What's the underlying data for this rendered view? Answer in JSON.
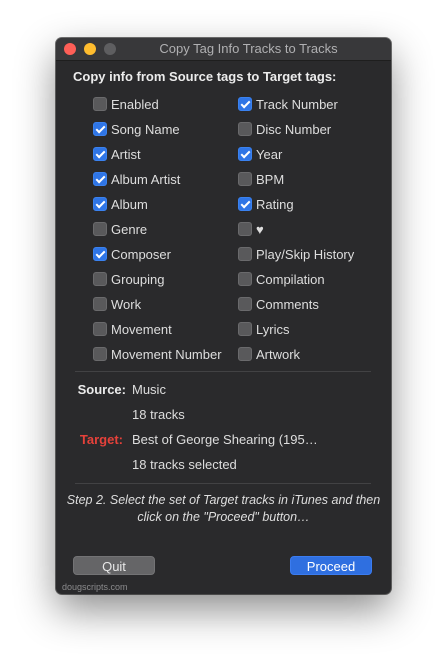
{
  "window": {
    "title": "Copy Tag Info Tracks to Tracks"
  },
  "header": "Copy info from Source tags to Target tags:",
  "tags_left": [
    {
      "label": "Enabled",
      "checked": false
    },
    {
      "label": "Song Name",
      "checked": true
    },
    {
      "label": "Artist",
      "checked": true
    },
    {
      "label": "Album Artist",
      "checked": true
    },
    {
      "label": "Album",
      "checked": true
    },
    {
      "label": "Genre",
      "checked": false
    },
    {
      "label": "Composer",
      "checked": true
    },
    {
      "label": "Grouping",
      "checked": false
    },
    {
      "label": "Work",
      "checked": false
    },
    {
      "label": "Movement",
      "checked": false
    },
    {
      "label": "Movement Number",
      "checked": false
    }
  ],
  "tags_right": [
    {
      "label": "Track Number",
      "checked": true
    },
    {
      "label": "Disc Number",
      "checked": false
    },
    {
      "label": "Year",
      "checked": true
    },
    {
      "label": "BPM",
      "checked": false
    },
    {
      "label": "Rating",
      "checked": true
    },
    {
      "label": "♥",
      "checked": false
    },
    {
      "label": "Play/Skip History",
      "checked": false
    },
    {
      "label": "Compilation",
      "checked": false
    },
    {
      "label": "Comments",
      "checked": false
    },
    {
      "label": "Lyrics",
      "checked": false
    },
    {
      "label": "Artwork",
      "checked": false
    }
  ],
  "source": {
    "label": "Source:",
    "name": "Music",
    "count": "18 tracks"
  },
  "target": {
    "label": "Target:",
    "name": "Best of George Shearing (195…",
    "count": "18 tracks selected"
  },
  "step_text": "Step 2. Select the set of Target tracks in iTunes and then click on the \"Proceed\" button…",
  "buttons": {
    "quit": "Quit",
    "proceed": "Proceed"
  },
  "footer": "dougscripts.com",
  "colors": {
    "window_bg": "#2a2a2c",
    "checkbox_checked": "#2f75e6",
    "target_label": "#e5413a",
    "source_label": "#ececec",
    "proceed_button": "#2f6fe0"
  }
}
